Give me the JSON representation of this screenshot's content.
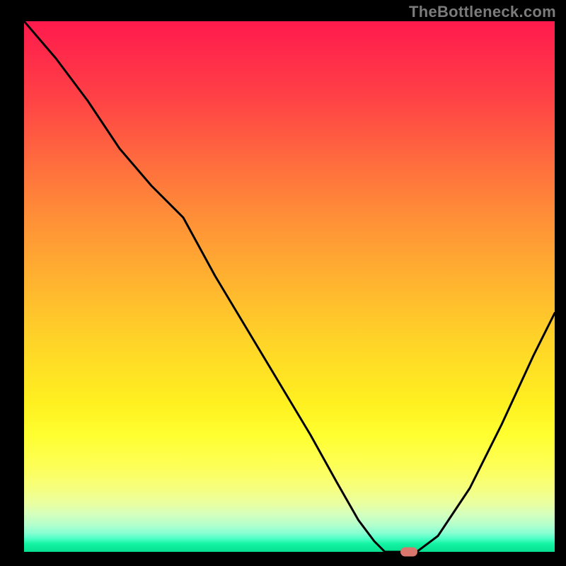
{
  "watermark": "TheBottleneck.com",
  "colors": {
    "background": "#000000",
    "curve": "#000000",
    "marker": "#d9766e",
    "watermark": "#7b7b7b"
  },
  "plot": {
    "x_range": [
      0,
      100
    ],
    "y_range": [
      0,
      100
    ]
  },
  "chart_data": {
    "type": "line",
    "title": "",
    "xlabel": "",
    "ylabel": "",
    "xlim": [
      0,
      100
    ],
    "ylim": [
      0,
      100
    ],
    "x": [
      0,
      6,
      12,
      18,
      24,
      30,
      36,
      42,
      48,
      54,
      59,
      63,
      66,
      68,
      71,
      74,
      78,
      84,
      90,
      96,
      100
    ],
    "y": [
      100,
      93,
      85,
      76,
      69,
      63,
      52,
      42,
      32,
      22,
      13,
      6,
      2,
      0,
      0,
      0,
      3,
      12,
      24,
      37,
      45
    ],
    "series": [
      {
        "name": "bottleneck-curve",
        "x": [
          0,
          6,
          12,
          18,
          24,
          30,
          36,
          42,
          48,
          54,
          59,
          63,
          66,
          68,
          71,
          74,
          78,
          84,
          90,
          96,
          100
        ],
        "y": [
          100,
          93,
          85,
          76,
          69,
          63,
          52,
          42,
          32,
          22,
          13,
          6,
          2,
          0,
          0,
          0,
          3,
          12,
          24,
          37,
          45
        ]
      }
    ],
    "marker": {
      "x": 72.5,
      "y": 0
    }
  }
}
